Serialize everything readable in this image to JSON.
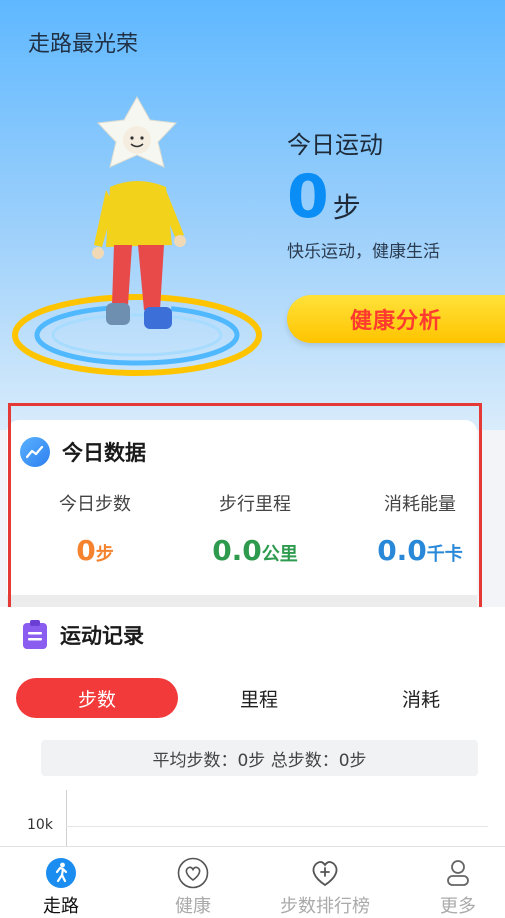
{
  "app": {
    "title": "走路最光荣"
  },
  "hero": {
    "today_label": "今日运动",
    "steps_value": "0",
    "steps_unit": "步",
    "slogan": "快乐运动，健康生活",
    "analysis_button": "健康分析"
  },
  "today_data": {
    "title": "今日数据",
    "stats": [
      {
        "label": "今日步数",
        "value": "0",
        "unit": "步",
        "color": "#f4822e"
      },
      {
        "label": "步行里程",
        "value": "0.0",
        "unit": "公里",
        "color": "#2e9a4e"
      },
      {
        "label": "消耗能量",
        "value": "0.0",
        "unit": "千卡",
        "color": "#2a88d8"
      }
    ]
  },
  "records": {
    "title": "运动记录",
    "tabs": [
      {
        "label": "步数",
        "active": true
      },
      {
        "label": "里程",
        "active": false
      },
      {
        "label": "消耗",
        "active": false
      }
    ],
    "summary": "平均步数：0步 总步数：0步",
    "y_tick": "10k"
  },
  "bottom_nav": [
    {
      "label": "走路",
      "icon": "walking-icon",
      "active": true
    },
    {
      "label": "健康",
      "icon": "heart-icon",
      "active": false
    },
    {
      "label": "步数排行榜",
      "icon": "heart-plus-icon",
      "active": false
    },
    {
      "label": "更多",
      "icon": "person-icon",
      "active": false
    }
  ],
  "colors": {
    "accent_blue": "#0a8ef5",
    "accent_red": "#f23a3a",
    "highlight_border": "#e53935",
    "button_yellow": "#ffd21f"
  }
}
